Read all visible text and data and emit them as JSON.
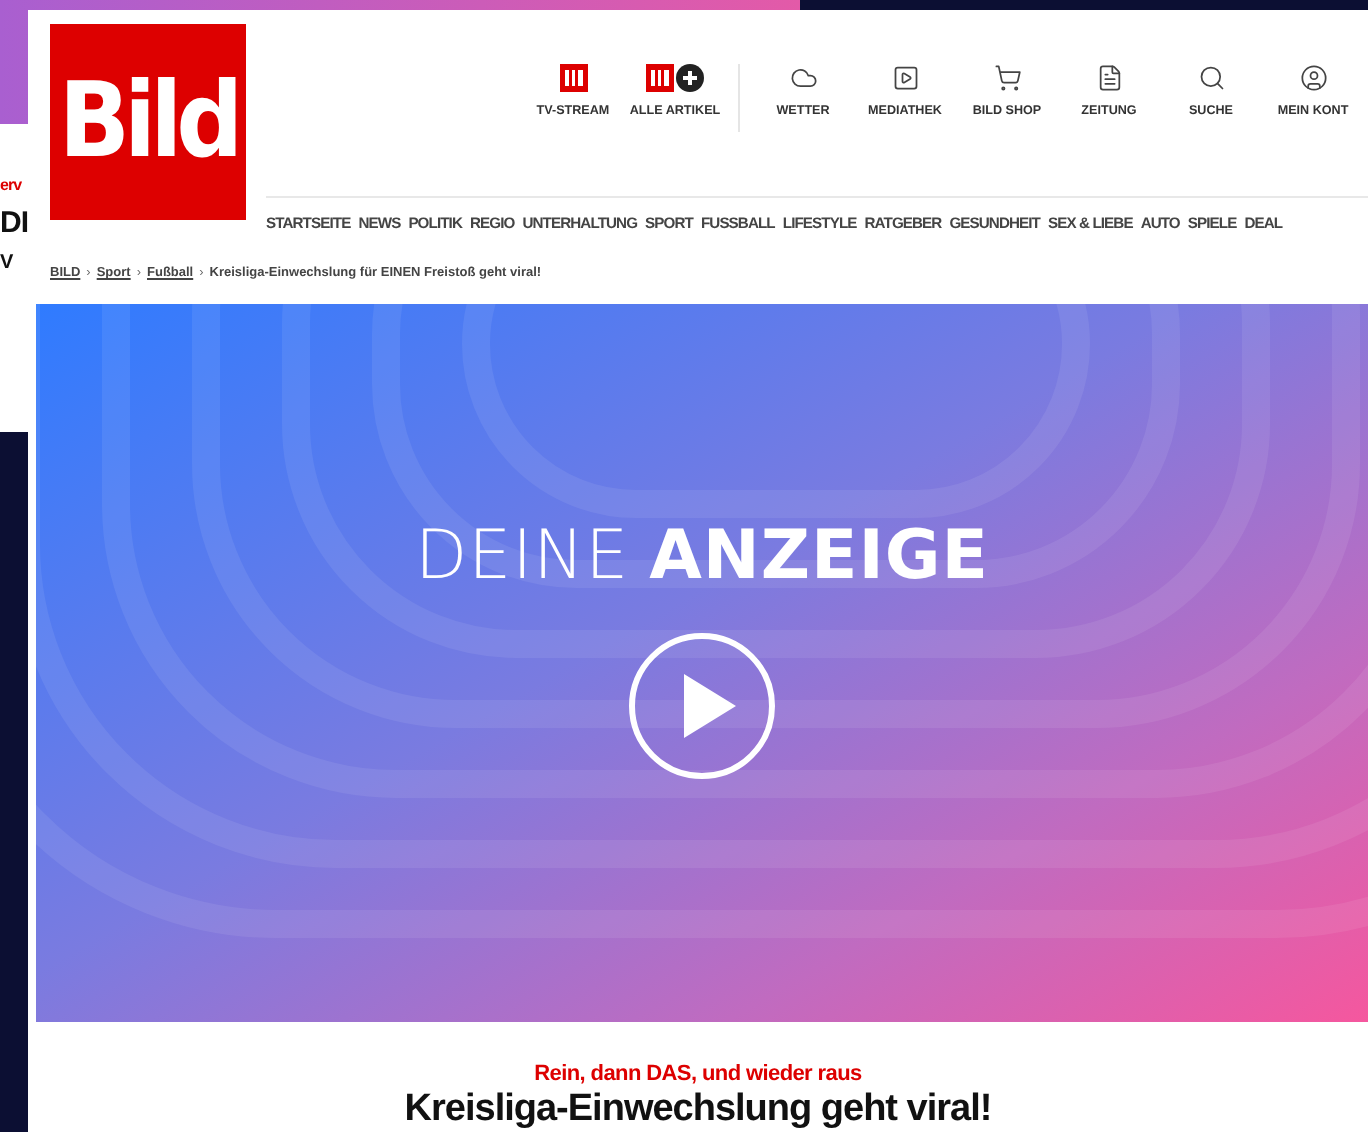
{
  "back_window": {
    "fragments": [
      {
        "text": "erv",
        "kind": "kicker"
      },
      {
        "text": "DI",
        "kind": "headline"
      },
      {
        "text": "V",
        "kind": "body"
      }
    ]
  },
  "header": {
    "logo": "Bild",
    "quick_links": [
      "TV-STREAM",
      "ALLE ARTIKEL",
      "WETTER",
      "MEDIATHEK",
      "BILD SHOP",
      "ZEITUNG",
      "SUCHE",
      "MEIN KONT"
    ],
    "nav": [
      "STARTSEITE",
      "NEWS",
      "POLITIK",
      "REGIO",
      "UNTERHALTUNG",
      "SPORT",
      "FUSSBALL",
      "LIFESTYLE",
      "RATGEBER",
      "GESUNDHEIT",
      "SEX & LIEBE",
      "AUTO",
      "SPIELE",
      "DEAL"
    ]
  },
  "breadcrumb": {
    "separator": "›",
    "items": [
      {
        "label": "BILD",
        "link": true
      },
      {
        "label": "Sport",
        "link": true
      },
      {
        "label": "Fußball",
        "link": true
      },
      {
        "label": "Kreisliga-Einwechslung für EINEN Freistoß geht viral!",
        "link": false
      }
    ]
  },
  "ad": {
    "label_light": "DEINE",
    "label_bold": "ANZEIGE"
  },
  "article": {
    "kicker": "Rein, dann DAS, und wieder raus",
    "headline": "Kreisliga-Einwechslung geht viral!"
  }
}
